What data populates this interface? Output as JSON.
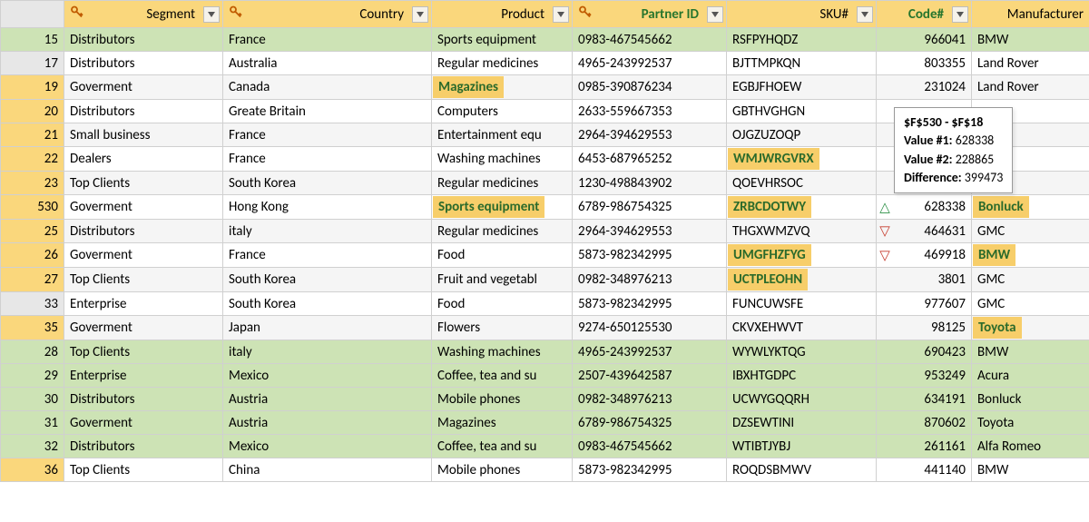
{
  "columns": {
    "segment": "Segment",
    "country": "Country",
    "product": "Product",
    "partner": "Partner ID",
    "sku": "SKU#",
    "code": "Code#",
    "manufacturer": "Manufacturer"
  },
  "tooltip": {
    "title": "$F$530 - $F$18",
    "v1_label": "Value #1:",
    "v1": "628338",
    "v2_label": "Value #2:",
    "v2": "228865",
    "diff_label": "Difference:",
    "diff": "399473"
  },
  "rows": [
    {
      "n": "15",
      "ny": false,
      "g": true,
      "seg": "Distributors",
      "cty": "France",
      "prod": "Sports equipment",
      "pid": "0983-467545662",
      "sku": "RSFPYHQDZ",
      "code": "966041",
      "manu": "BMW"
    },
    {
      "n": "17",
      "ny": false,
      "seg": "Distributors",
      "cty": "Australia",
      "prod": "Regular medicines",
      "pid": "4965-243992537",
      "sku": "BJTTMPKQN",
      "code": "803355",
      "manu": "Land Rover"
    },
    {
      "n": "19",
      "ny": true,
      "alt": true,
      "seg": "Goverment",
      "cty": "Canada",
      "prod": "Magazines",
      "prod_hl": true,
      "pid": "0985-390876234",
      "sku": "EGBJFHOEW",
      "code": "231024",
      "manu": "Land Rover"
    },
    {
      "n": "20",
      "ny": true,
      "seg": "Distributors",
      "cty": "Greate Britain",
      "prod": "Computers",
      "pid": "2633-559667353",
      "sku": "GBTHVGHGN",
      "code": "",
      "manu": "r"
    },
    {
      "n": "21",
      "ny": true,
      "alt": true,
      "seg": "Small business",
      "cty": "France",
      "prod": "Entertainment equ",
      "pid": "2964-394629553",
      "sku": "OJGZUZOQP",
      "code": "",
      "manu": ""
    },
    {
      "n": "22",
      "ny": true,
      "seg": "Dealers",
      "cty": "France",
      "prod": "Washing machines",
      "pid": "6453-687965252",
      "sku": "WMJWRGVRX",
      "sku_hl": true,
      "code": "",
      "manu": ""
    },
    {
      "n": "23",
      "ny": true,
      "alt": true,
      "seg": "Top Clients",
      "cty": "South Korea",
      "prod": "Regular medicines",
      "pid": "1230-498843902",
      "sku": "QOEVHRSOC",
      "code": "",
      "manu": ""
    },
    {
      "n": "530",
      "ny": true,
      "seg": "Goverment",
      "cty": "Hong Kong",
      "prod": "Sports equipment",
      "prod_hl": true,
      "pid": "6789-986754325",
      "sku": "ZRBCDOTWY",
      "sku_hl": true,
      "code": "628338",
      "marker": "up",
      "manu": "Bonluck",
      "manu_hl": true
    },
    {
      "n": "25",
      "ny": true,
      "alt": true,
      "seg": "Distributors",
      "cty": "italy",
      "prod": "Regular medicines",
      "pid": "2964-394629553",
      "sku": "THGXWMZVQ",
      "code": "464631",
      "marker": "down",
      "manu": "GMC"
    },
    {
      "n": "26",
      "ny": true,
      "seg": "Goverment",
      "cty": "France",
      "prod": "Food",
      "pid": "5873-982342995",
      "sku": "UMGFHZFYG",
      "sku_hl": true,
      "code": "469918",
      "marker": "down",
      "manu": "BMW",
      "manu_hl": true
    },
    {
      "n": "27",
      "ny": true,
      "alt": true,
      "seg": "Top Clients",
      "cty": "South Korea",
      "prod": "Fruit and vegetabl",
      "pid": "0982-348976213",
      "sku": "UCTPLEOHN",
      "sku_hl": true,
      "code": "3801",
      "manu": "GMC"
    },
    {
      "n": "33",
      "ny": false,
      "seg": "Enterprise",
      "cty": "South Korea",
      "prod": "Food",
      "pid": "5873-982342995",
      "sku": "FUNCUWSFE",
      "code": "977607",
      "manu": "GMC"
    },
    {
      "n": "35",
      "ny": true,
      "alt": true,
      "seg": "Goverment",
      "cty": "Japan",
      "prod": "Flowers",
      "pid": "9274-650125530",
      "sku": "CKVXEHWVT",
      "code": "98125",
      "manu": "Toyota",
      "manu_hl": true
    },
    {
      "n": "28",
      "ny": false,
      "g": true,
      "seg": "Top Clients",
      "cty": "italy",
      "prod": "Washing machines",
      "pid": "4965-243992537",
      "sku": "WYWLYKTQG",
      "code": "690423",
      "manu": "BMW"
    },
    {
      "n": "29",
      "ny": false,
      "g": true,
      "seg": "Enterprise",
      "cty": "Mexico",
      "prod": "Coffee, tea and su",
      "pid": "2507-439642587",
      "sku": "IBXHTGDPC",
      "code": "953249",
      "manu": "Acura"
    },
    {
      "n": "30",
      "ny": false,
      "g": true,
      "seg": "Distributors",
      "cty": "Austria",
      "prod": "Mobile phones",
      "pid": "0982-348976213",
      "sku": "UCWYGQQRH",
      "code": "634191",
      "manu": "Bonluck"
    },
    {
      "n": "31",
      "ny": false,
      "g": true,
      "seg": "Goverment",
      "cty": "Austria",
      "prod": "Magazines",
      "pid": "6789-986754325",
      "sku": "DZSEWTINI",
      "code": "870602",
      "manu": "Toyota"
    },
    {
      "n": "32",
      "ny": false,
      "g": true,
      "seg": "Distributors",
      "cty": "Mexico",
      "prod": "Coffee, tea and su",
      "pid": "0983-467545662",
      "sku": "WTIBTJYBJ",
      "code": "261161",
      "manu": "Alfa Romeo"
    },
    {
      "n": "36",
      "ny": true,
      "seg": "Top Clients",
      "cty": "China",
      "prod": "Mobile phones",
      "pid": "5873-982342995",
      "sku": "ROQDSBMWV",
      "code": "441140",
      "manu": "BMW"
    }
  ]
}
